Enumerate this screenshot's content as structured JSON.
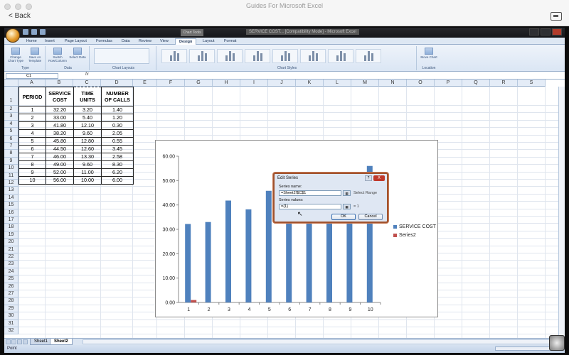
{
  "app": {
    "title": "Guides For Microsoft Excel",
    "back_label": "< Back"
  },
  "excel": {
    "window_title": "SERVICE COST... [Compatibility Mode] - Microsoft Excel",
    "context_tab": "Chart Tools",
    "tabs": [
      "Home",
      "Insert",
      "Page Layout",
      "Formulas",
      "Data",
      "Review",
      "View",
      "Design",
      "Layout",
      "Format"
    ],
    "active_tab": "Design",
    "ribbon": {
      "type_group": "Type",
      "data_group": "Data",
      "layouts_group": "Chart Layouts",
      "styles_group": "Chart Styles",
      "location_group": "Location",
      "change_chart_type": "Change Chart Type",
      "save_as_template": "Save As Template",
      "switch_row_column": "Switch Row/Column",
      "select_data": "Select Data",
      "move_chart": "Move Chart"
    },
    "name_box": "C1",
    "fx": "fx",
    "columns": [
      "A",
      "B",
      "C",
      "D",
      "E",
      "F",
      "G",
      "H",
      "I",
      "J",
      "K",
      "L",
      "M",
      "N",
      "O",
      "P",
      "Q",
      "R",
      "S"
    ],
    "rows": [
      "1",
      "2",
      "3",
      "4",
      "5",
      "6",
      "7",
      "8",
      "9",
      "10",
      "11",
      "12",
      "13",
      "14",
      "15",
      "16",
      "17",
      "18",
      "19",
      "20",
      "21",
      "22",
      "23",
      "24",
      "25",
      "26",
      "27",
      "28",
      "29",
      "30",
      "31",
      "32"
    ],
    "table": {
      "headers": [
        "PERIOD",
        "SERVICE COST",
        "TIME UNITS",
        "NUMBER OF CALLS"
      ],
      "header_lines": [
        [
          "PERIOD"
        ],
        [
          "SERVICE",
          "COST"
        ],
        [
          "TIME",
          "UNITS"
        ],
        [
          "NUMBER",
          "OF CALLS"
        ]
      ],
      "rows": [
        [
          "1",
          "32.20",
          "3.20",
          "1.40"
        ],
        [
          "2",
          "33.00",
          "5.40",
          "1.20"
        ],
        [
          "3",
          "41.80",
          "12.10",
          "0.30"
        ],
        [
          "4",
          "38.20",
          "9.60",
          "2.05"
        ],
        [
          "5",
          "45.80",
          "12.80",
          "0.55"
        ],
        [
          "6",
          "44.50",
          "12.60",
          "3.45"
        ],
        [
          "7",
          "46.00",
          "13.30",
          "2.58"
        ],
        [
          "8",
          "49.00",
          "9.60",
          "8.30"
        ],
        [
          "9",
          "52.00",
          "11.00",
          "6.20"
        ],
        [
          "10",
          "56.00",
          "10.00",
          "6.00"
        ]
      ]
    },
    "sheet_tabs": [
      "Sheet1",
      "Sheet2"
    ],
    "active_sheet": "Sheet2",
    "status": "Point"
  },
  "dialog": {
    "title": "Edit Series",
    "name_label": "Series name:",
    "name_value": "=Sheet2!$C$1",
    "select_range": "Select Range",
    "values_label": "Series values:",
    "values_value": "={1}",
    "values_preview": "= 1",
    "ok": "OK",
    "cancel": "Cancel",
    "help": "?",
    "close": "X"
  },
  "chart_data": {
    "type": "bar",
    "categories": [
      "1",
      "2",
      "3",
      "4",
      "5",
      "6",
      "7",
      "8",
      "9",
      "10"
    ],
    "series": [
      {
        "name": "SERVICE COST",
        "values": [
          32.2,
          33.0,
          41.8,
          38.2,
          45.8,
          44.5,
          46.0,
          49.0,
          52.0,
          56.0
        ],
        "color": "#4f81bd"
      },
      {
        "name": "Series2",
        "values": [
          1,
          0,
          0,
          0,
          0,
          0,
          0,
          0,
          0,
          0
        ],
        "color": "#c0504d"
      }
    ],
    "yticks": [
      "0.00",
      "10.00",
      "20.00",
      "30.00",
      "40.00",
      "50.00",
      "60.00"
    ],
    "ylim": [
      0,
      60
    ],
    "legend": "right",
    "grid": false
  }
}
